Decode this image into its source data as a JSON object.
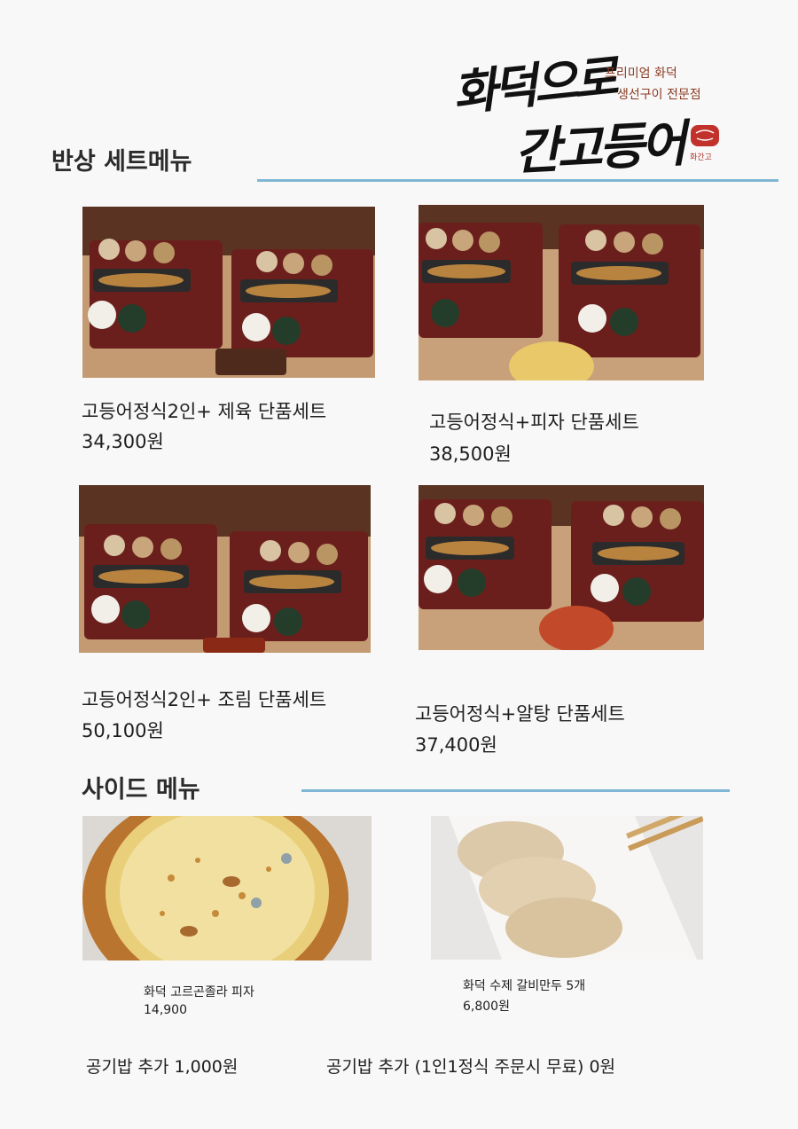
{
  "header": {
    "logo_line1": "화덕으로",
    "logo_line2": "간고등어",
    "tagline_line1": "프리미엄 화덕",
    "tagline_line2": "생선구이 전문점",
    "seal_label": "화간고"
  },
  "set_menu": {
    "title": "반상 세트메뉴",
    "items": [
      {
        "name": "고등어정식2인+ 제육 단품세트",
        "price": "34,300원"
      },
      {
        "name": "고등어정식+피자 단품세트",
        "price": "38,500원"
      },
      {
        "name": "고등어정식2인+ 조림 단품세트",
        "price": "50,100원"
      },
      {
        "name": "고등어정식+알탕 단품세트",
        "price": "37,400원"
      }
    ]
  },
  "side_menu": {
    "title": "사이드 메뉴",
    "items": [
      {
        "name": "화덕 고르곤졸라 피자",
        "price": "14,900"
      },
      {
        "name": "화덕 수제 갈비만두 5개",
        "price": "6,800원"
      }
    ]
  },
  "footer": {
    "rice_add": "공기밥 추가 1,000원",
    "rice_add_free": "공기밥 추가 (1인1정식 주문시 무료) 0원"
  }
}
